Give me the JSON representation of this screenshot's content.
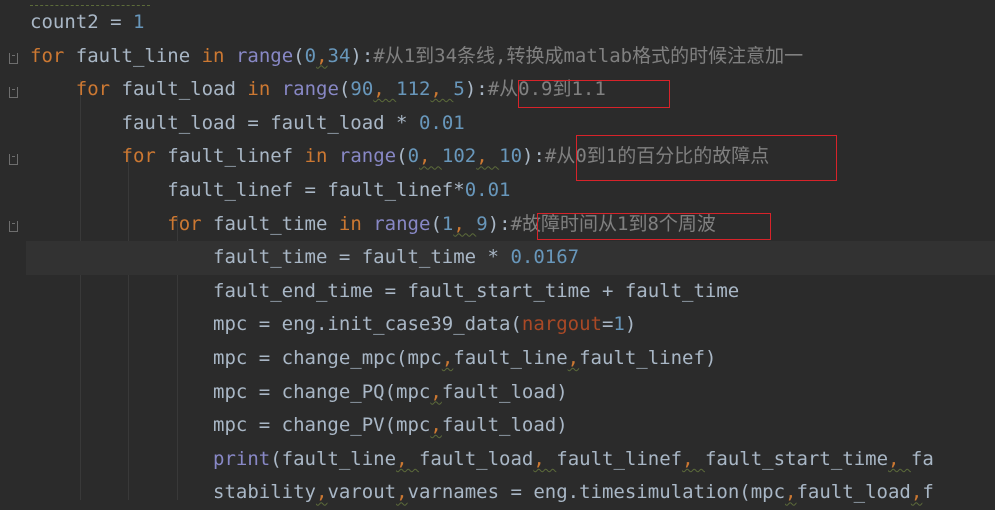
{
  "editor": {
    "lines": [
      {
        "segments": [
          {
            "t": "count2",
            "c": "id"
          },
          {
            "t": " = ",
            "c": "id"
          },
          {
            "t": "1",
            "c": "num"
          }
        ]
      },
      {
        "segments": [
          {
            "t": "for",
            "c": "kw"
          },
          {
            "t": " fault_line ",
            "c": "id"
          },
          {
            "t": "in",
            "c": "kw"
          },
          {
            "t": " ",
            "c": "id"
          },
          {
            "t": "range",
            "c": "builtin"
          },
          {
            "t": "(",
            "c": "id"
          },
          {
            "t": "0",
            "c": "num"
          },
          {
            "t": ",",
            "c": "punc"
          },
          {
            "t": "34",
            "c": "num"
          },
          {
            "t": "):",
            "c": "id"
          },
          {
            "t": "#从1到34条线,转换成matlab格式的时候注意加一",
            "c": "cm"
          }
        ]
      },
      {
        "segments": [
          {
            "t": "    ",
            "c": "id"
          },
          {
            "t": "for",
            "c": "kw"
          },
          {
            "t": " fault_load ",
            "c": "id"
          },
          {
            "t": "in",
            "c": "kw"
          },
          {
            "t": " ",
            "c": "id"
          },
          {
            "t": "range",
            "c": "builtin"
          },
          {
            "t": "(",
            "c": "id"
          },
          {
            "t": "90",
            "c": "num"
          },
          {
            "t": ", ",
            "c": "punc"
          },
          {
            "t": "112",
            "c": "num"
          },
          {
            "t": ", ",
            "c": "punc"
          },
          {
            "t": "5",
            "c": "num"
          },
          {
            "t": "):",
            "c": "id"
          },
          {
            "t": "#从0.9到1.1",
            "c": "cm"
          }
        ]
      },
      {
        "segments": [
          {
            "t": "        fault_load = fault_load * ",
            "c": "id"
          },
          {
            "t": "0.01",
            "c": "num"
          }
        ]
      },
      {
        "segments": [
          {
            "t": "        ",
            "c": "id"
          },
          {
            "t": "for",
            "c": "kw"
          },
          {
            "t": " fault_linef ",
            "c": "id"
          },
          {
            "t": "in",
            "c": "kw"
          },
          {
            "t": " ",
            "c": "id"
          },
          {
            "t": "range",
            "c": "builtin"
          },
          {
            "t": "(",
            "c": "id"
          },
          {
            "t": "0",
            "c": "num"
          },
          {
            "t": ", ",
            "c": "punc"
          },
          {
            "t": "102",
            "c": "num"
          },
          {
            "t": ", ",
            "c": "punc"
          },
          {
            "t": "10",
            "c": "num"
          },
          {
            "t": "):",
            "c": "id"
          },
          {
            "t": "#从0到1的百分比的故障点",
            "c": "cm"
          }
        ]
      },
      {
        "segments": [
          {
            "t": "            fault_linef = fault_linef*",
            "c": "id"
          },
          {
            "t": "0.01",
            "c": "num"
          }
        ]
      },
      {
        "segments": [
          {
            "t": "            ",
            "c": "id"
          },
          {
            "t": "for",
            "c": "kw"
          },
          {
            "t": " fault_time ",
            "c": "id"
          },
          {
            "t": "in",
            "c": "kw"
          },
          {
            "t": " ",
            "c": "id"
          },
          {
            "t": "range",
            "c": "builtin"
          },
          {
            "t": "(",
            "c": "id"
          },
          {
            "t": "1",
            "c": "num"
          },
          {
            "t": ", ",
            "c": "punc"
          },
          {
            "t": "9",
            "c": "num"
          },
          {
            "t": "):",
            "c": "id"
          },
          {
            "t": "#故障时间从1到8个周波",
            "c": "cm"
          }
        ]
      },
      {
        "segments": [
          {
            "t": "                fault_time = fault_time * ",
            "c": "id"
          },
          {
            "t": "0.0167",
            "c": "num"
          }
        ]
      },
      {
        "segments": [
          {
            "t": "                fault_end_time = fault_start_time + fault_time",
            "c": "id"
          }
        ]
      },
      {
        "segments": [
          {
            "t": "                mpc = eng.init_case39_data(",
            "c": "id"
          },
          {
            "t": "nargout",
            "c": "kwarg"
          },
          {
            "t": "=",
            "c": "id"
          },
          {
            "t": "1",
            "c": "num"
          },
          {
            "t": ")",
            "c": "id"
          }
        ]
      },
      {
        "segments": [
          {
            "t": "                mpc = change_mpc(mpc",
            "c": "id"
          },
          {
            "t": ",",
            "c": "punc"
          },
          {
            "t": "fault_line",
            "c": "id"
          },
          {
            "t": ",",
            "c": "punc"
          },
          {
            "t": "fault_linef)",
            "c": "id"
          }
        ]
      },
      {
        "segments": [
          {
            "t": "                mpc = change_PQ(mpc",
            "c": "id"
          },
          {
            "t": ",",
            "c": "punc"
          },
          {
            "t": "fault_load)",
            "c": "id"
          }
        ]
      },
      {
        "segments": [
          {
            "t": "                mpc = change_PV(mpc",
            "c": "id"
          },
          {
            "t": ",",
            "c": "punc"
          },
          {
            "t": "fault_load)",
            "c": "id"
          }
        ]
      },
      {
        "segments": [
          {
            "t": "                ",
            "c": "id"
          },
          {
            "t": "print",
            "c": "builtin"
          },
          {
            "t": "(fault_line",
            "c": "id"
          },
          {
            "t": ", ",
            "c": "punc"
          },
          {
            "t": "fault_load",
            "c": "id"
          },
          {
            "t": ", ",
            "c": "punc"
          },
          {
            "t": "fault_linef",
            "c": "id"
          },
          {
            "t": ", ",
            "c": "punc"
          },
          {
            "t": "fault_start_time",
            "c": "id"
          },
          {
            "t": ", ",
            "c": "punc"
          },
          {
            "t": "fa",
            "c": "id"
          }
        ]
      },
      {
        "segments": [
          {
            "t": "                stability",
            "c": "id"
          },
          {
            "t": ",",
            "c": "punc"
          },
          {
            "t": "varout",
            "c": "id"
          },
          {
            "t": ",",
            "c": "punc"
          },
          {
            "t": "varnames = eng.timesimulation(mpc",
            "c": "id"
          },
          {
            "t": ",",
            "c": "punc"
          },
          {
            "t": "fault_load",
            "c": "id"
          },
          {
            "t": ",",
            "c": "punc"
          },
          {
            "t": "f",
            "c": "id"
          }
        ]
      }
    ],
    "current_line": 7,
    "colors": {
      "background": "#2b2b2b",
      "text": "#a9b7c6",
      "keyword": "#cc7832",
      "number": "#6897bb",
      "comment": "#808080",
      "builtin": "#8888c6",
      "kwarg": "#aa4926",
      "annotation_box": "#d8232a"
    }
  }
}
